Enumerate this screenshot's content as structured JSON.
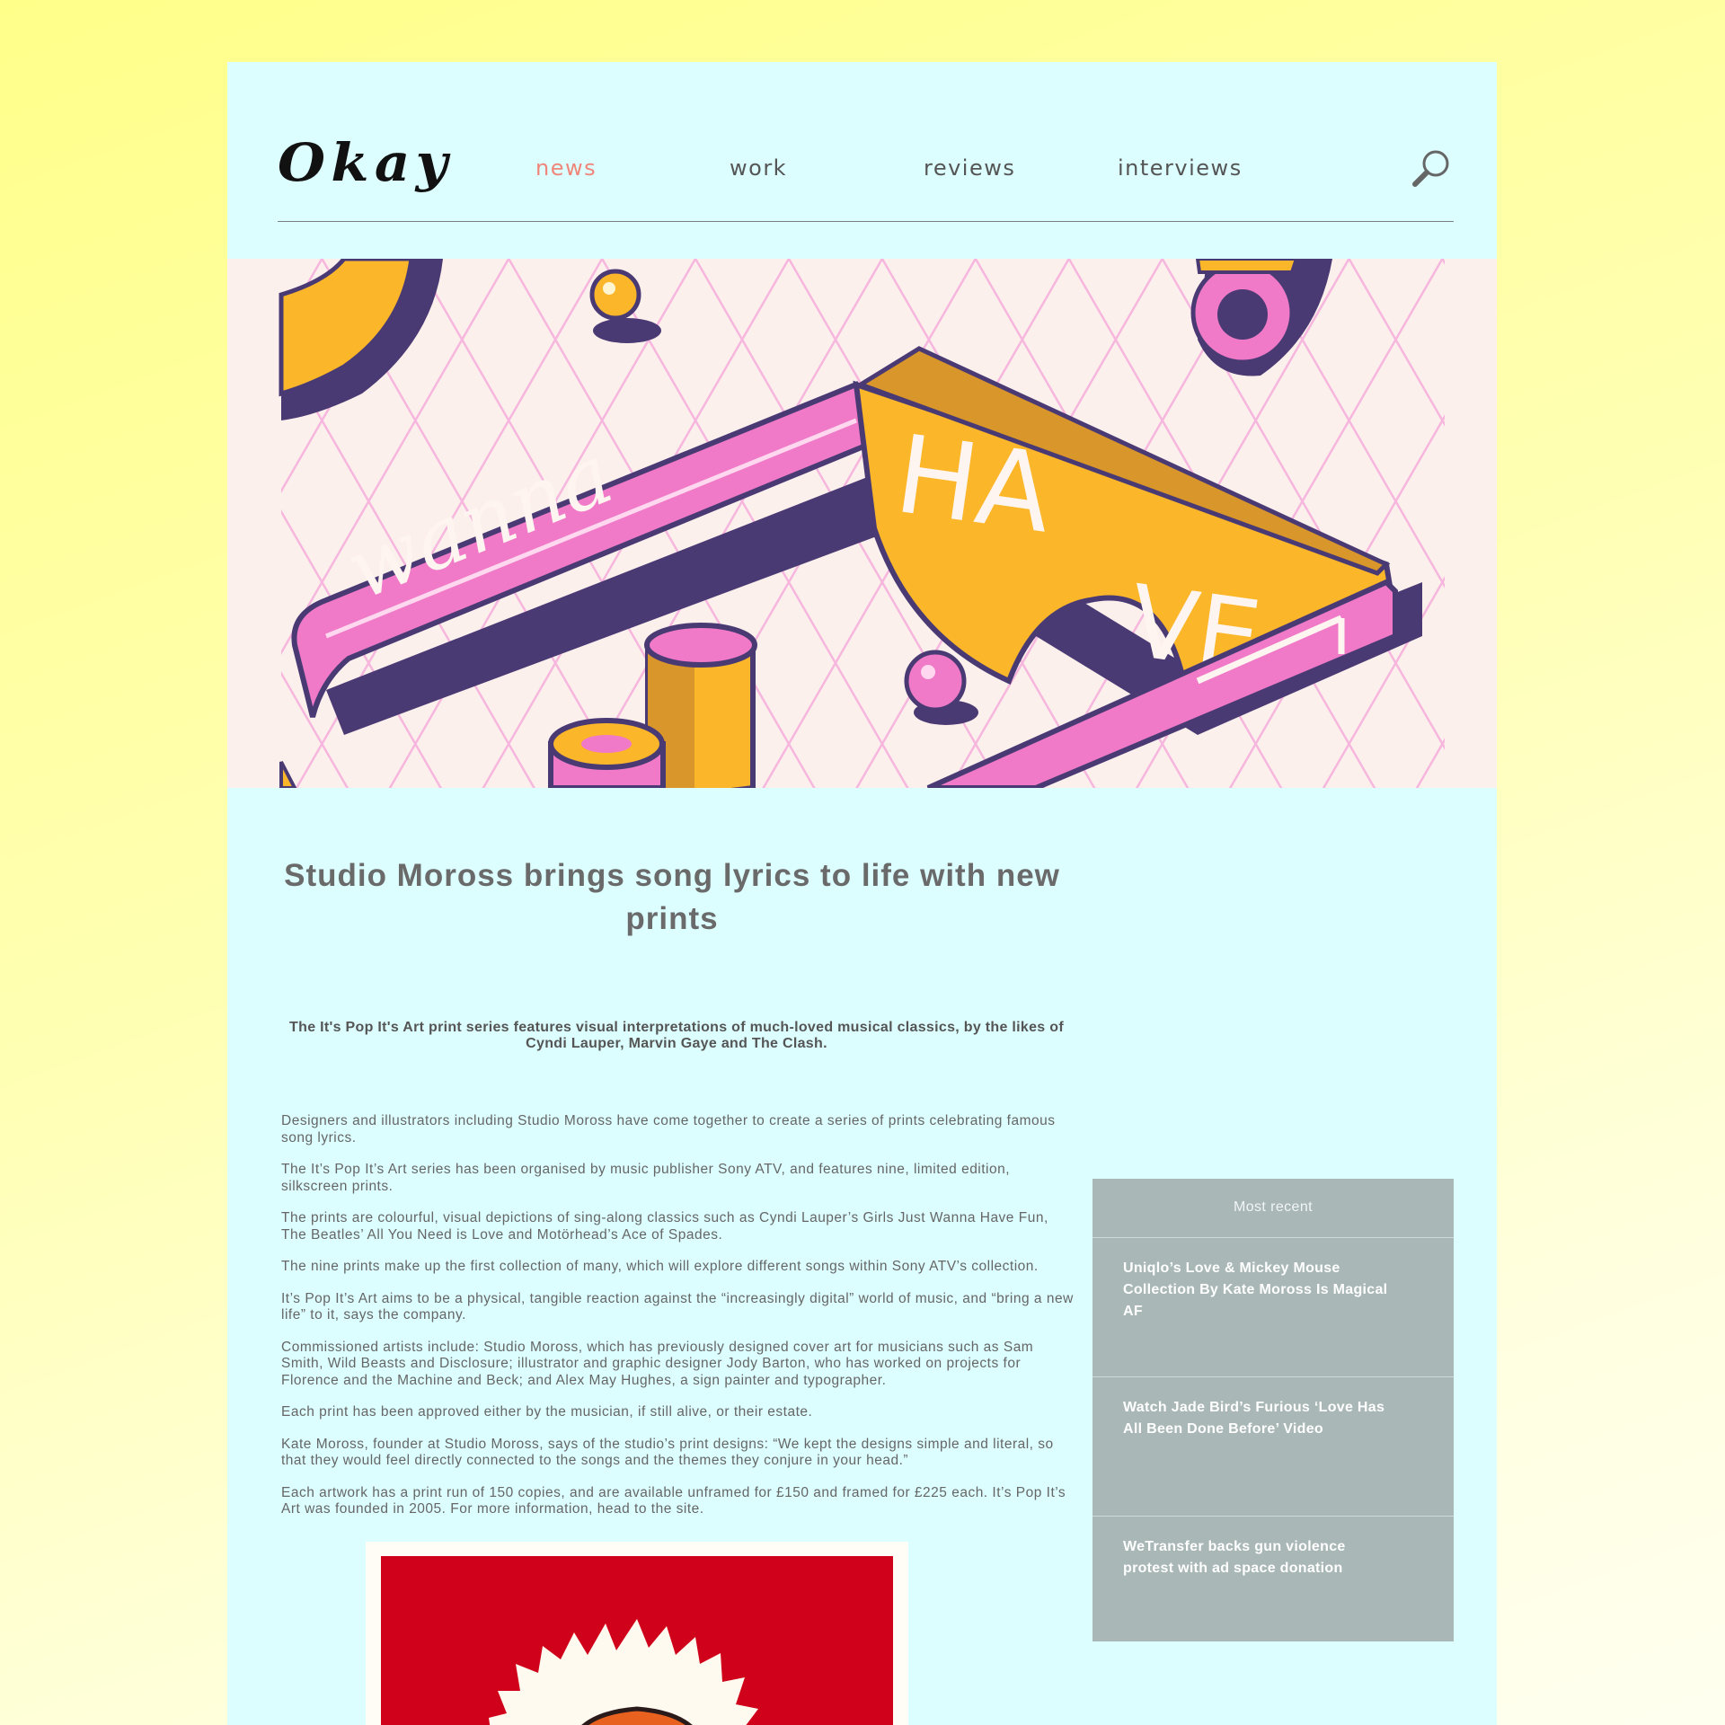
{
  "header": {
    "logo": "Okay",
    "nav": [
      {
        "label": "news",
        "active": true
      },
      {
        "label": "work",
        "active": false
      },
      {
        "label": "reviews",
        "active": false
      },
      {
        "label": "interviews",
        "active": false
      }
    ],
    "search_icon": "search-icon"
  },
  "hero": {
    "lettering": [
      "wanna",
      "HA",
      "VE"
    ]
  },
  "article": {
    "title": "Studio Moross brings song lyrics to life with new prints",
    "standfirst": "The It's Pop It's Art print series features visual interpretations of much-loved musical classics, by the likes of Cyndi Lauper, Marvin Gaye and The Clash.",
    "paragraphs": [
      "Designers and illustrators including Studio Moross have come together to create a series of prints celebrating famous song lyrics.",
      "The It’s Pop It’s Art series has been organised by music publisher Sony ATV, and features nine, limited edition, silkscreen prints.",
      "The prints are colourful, visual depictions of sing-along classics such as Cyndi Lauper’s Girls Just Wanna Have Fun, The Beatles’ All You Need is Love and Motörhead’s Ace of Spades.",
      "The nine prints make up the first collection of many, which will explore different songs within Sony ATV’s collection.",
      "It’s Pop It’s Art aims to be a physical, tangible reaction against the “increasingly digital” world of music, and “bring a new life” to it, says the company.",
      "Commissioned artists include: Studio Moross, which has previously designed cover art for musicians such as Sam Smith, Wild Beasts and Disclosure; illustrator and graphic designer Jody Barton, who has worked on projects for Florence and the Machine and Beck; and Alex May Hughes, a sign painter and typographer.",
      "Each print has been approved either by the musician, if still alive, or their estate.",
      "Kate Moross, founder at Studio Moross, says of the studio’s print designs: “We kept the designs simple and literal, so that they would feel directly connected to the songs and the themes they conjure in your head.”",
      "Each artwork has a print run of 150 copies, and are available unframed for £150 and framed for £225 each. It’s Pop It’s Art was founded in 2005. For more information, head to the site."
    ]
  },
  "sidebar": {
    "heading": "Most recent",
    "items": [
      "Uniqlo’s Love & Mickey Mouse Collection By Kate Moross Is Magical AF",
      "Watch Jade Bird’s Furious ‘Love Has All Been Done Before’ Video",
      "WeTransfer backs gun violence protest with ad space donation"
    ]
  },
  "colors": {
    "page_bg": "#dcfeff",
    "nav_active": "#f0857a",
    "sidebar_bg": "#a9b7b7",
    "hero_pink": "#f07ac7",
    "hero_yellow": "#fbb62a",
    "hero_purple": "#4a3a74",
    "print_red": "#d0011a"
  }
}
